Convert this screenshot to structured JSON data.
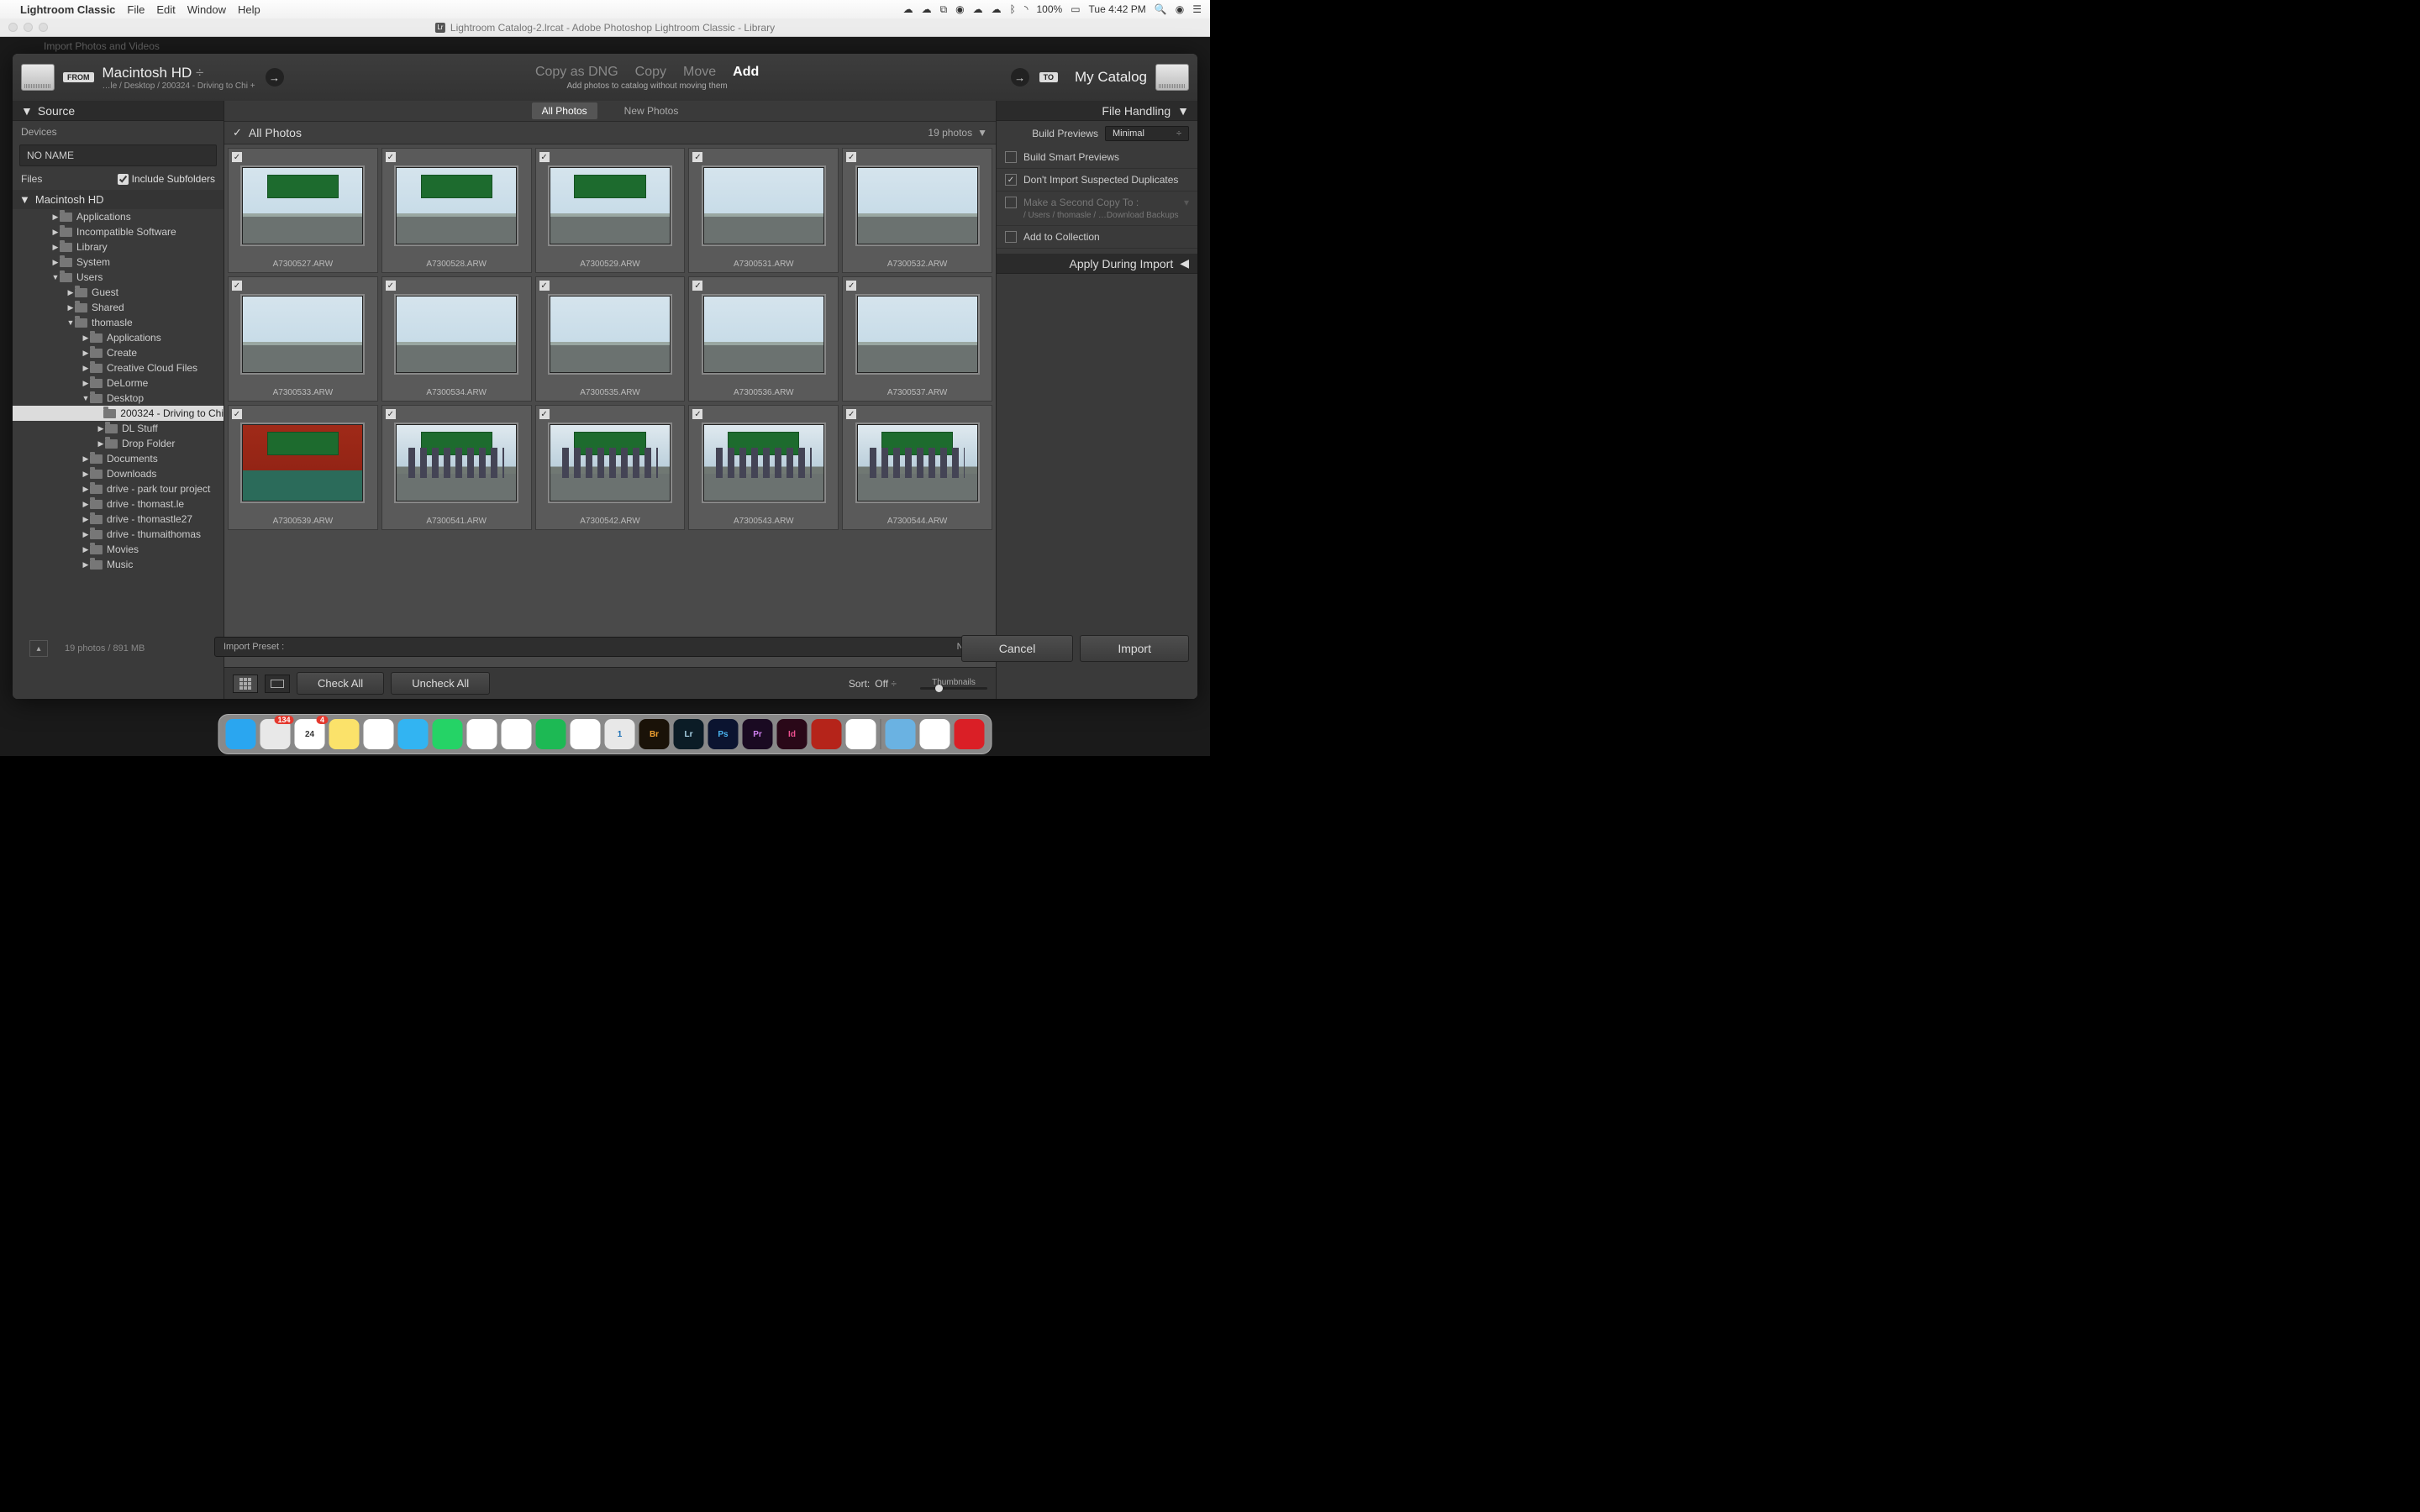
{
  "menubar": {
    "app": "Lightroom Classic",
    "items": [
      "File",
      "Edit",
      "Window",
      "Help"
    ],
    "battery": "100%",
    "clock": "Tue 4:42 PM"
  },
  "window_title": "Lightroom Catalog-2.lrcat - Adobe Photoshop Lightroom Classic - Library",
  "import_peek": "Import Photos and Videos",
  "header": {
    "from_label": "FROM",
    "source_name": "Macintosh HD",
    "source_path": "…le / Desktop / 200324 - Driving to Chi +",
    "modes": [
      "Copy as DNG",
      "Copy",
      "Move",
      "Add"
    ],
    "active_mode": "Add",
    "caption": "Add photos to catalog without moving them",
    "to_label": "TO",
    "dest_name": "My Catalog"
  },
  "left": {
    "source_title": "Source",
    "devices_label": "Devices",
    "device_name": "NO NAME",
    "files_label": "Files",
    "include_subfolders": "Include Subfolders",
    "disk_name": "Macintosh HD",
    "tree": [
      {
        "indent": 0,
        "label": "Applications",
        "expand": "▶",
        "active": false
      },
      {
        "indent": 0,
        "label": "Incompatible Software",
        "expand": "▶",
        "active": false
      },
      {
        "indent": 0,
        "label": "Library",
        "expand": "▶",
        "active": false
      },
      {
        "indent": 0,
        "label": "System",
        "expand": "▶",
        "active": false
      },
      {
        "indent": 0,
        "label": "Users",
        "expand": "▼",
        "active": false
      },
      {
        "indent": 1,
        "label": "Guest",
        "expand": "▶",
        "active": false
      },
      {
        "indent": 1,
        "label": "Shared",
        "expand": "▶",
        "active": false
      },
      {
        "indent": 1,
        "label": "thomasle",
        "expand": "▼",
        "active": false
      },
      {
        "indent": 2,
        "label": "Applications",
        "expand": "▶",
        "active": false
      },
      {
        "indent": 2,
        "label": "Create",
        "expand": "▶",
        "active": false
      },
      {
        "indent": 2,
        "label": "Creative Cloud Files",
        "expand": "▶",
        "active": false
      },
      {
        "indent": 2,
        "label": "DeLorme",
        "expand": "▶",
        "active": false
      },
      {
        "indent": 2,
        "label": "Desktop",
        "expand": "▼",
        "active": false
      },
      {
        "indent": 3,
        "label": "200324 - Driving to Chi",
        "expand": "",
        "active": true
      },
      {
        "indent": 3,
        "label": "DL Stuff",
        "expand": "▶",
        "active": false
      },
      {
        "indent": 3,
        "label": "Drop Folder",
        "expand": "▶",
        "active": false
      },
      {
        "indent": 2,
        "label": "Documents",
        "expand": "▶",
        "active": false
      },
      {
        "indent": 2,
        "label": "Downloads",
        "expand": "▶",
        "active": false
      },
      {
        "indent": 2,
        "label": "drive - park tour project",
        "expand": "▶",
        "active": false
      },
      {
        "indent": 2,
        "label": "drive - thomast.le",
        "expand": "▶",
        "active": false
      },
      {
        "indent": 2,
        "label": "drive - thomastle27",
        "expand": "▶",
        "active": false
      },
      {
        "indent": 2,
        "label": "drive - thumaithomas",
        "expand": "▶",
        "active": false
      },
      {
        "indent": 2,
        "label": "Movies",
        "expand": "▶",
        "active": false
      },
      {
        "indent": 2,
        "label": "Music",
        "expand": "▶",
        "active": false
      }
    ]
  },
  "center": {
    "tab_all": "All Photos",
    "tab_new": "New Photos",
    "header_title": "All Photos",
    "count_text": "19 photos",
    "photos": [
      {
        "name": "A7300527.ARW",
        "kind": "sign"
      },
      {
        "name": "A7300528.ARW",
        "kind": "sign"
      },
      {
        "name": "A7300529.ARW",
        "kind": "sign"
      },
      {
        "name": "A7300531.ARW",
        "kind": "nosign"
      },
      {
        "name": "A7300532.ARW",
        "kind": "nosign"
      },
      {
        "name": "A7300533.ARW",
        "kind": "nosign"
      },
      {
        "name": "A7300534.ARW",
        "kind": "nosign"
      },
      {
        "name": "A7300535.ARW",
        "kind": "nosign"
      },
      {
        "name": "A7300536.ARW",
        "kind": "nosign"
      },
      {
        "name": "A7300537.ARW",
        "kind": "nosign"
      },
      {
        "name": "A7300539.ARW",
        "kind": "mural"
      },
      {
        "name": "A7300541.ARW",
        "kind": "city"
      },
      {
        "name": "A7300542.ARW",
        "kind": "city"
      },
      {
        "name": "A7300543.ARW",
        "kind": "city"
      },
      {
        "name": "A7300544.ARW",
        "kind": "city"
      }
    ],
    "check_all": "Check All",
    "uncheck_all": "Uncheck All",
    "sort_label": "Sort:",
    "sort_value": "Off",
    "thumbnails_label": "Thumbnails"
  },
  "right": {
    "file_handling": "File Handling",
    "build_previews_label": "Build Previews",
    "build_previews_value": "Minimal",
    "smart_previews": "Build Smart Previews",
    "no_duplicates": "Don't Import Suspected Duplicates",
    "second_copy": "Make a Second Copy To :",
    "second_copy_path": "/ Users / thomasle / …Download Backups",
    "add_collection": "Add to Collection",
    "apply_during": "Apply During Import"
  },
  "preset": {
    "label": "Import Preset :",
    "value": "None"
  },
  "status_info": "19 photos / 891 MB",
  "buttons": {
    "cancel": "Cancel",
    "import": "Import"
  },
  "dock": [
    {
      "name": "finder",
      "bg": "#2aa6f0",
      "text": ""
    },
    {
      "name": "preview",
      "bg": "#e8e8e8",
      "text": "",
      "badge": "134"
    },
    {
      "name": "calendar",
      "bg": "#fff",
      "text": "24",
      "badge": "4",
      "color": "#333"
    },
    {
      "name": "notes",
      "bg": "#fbe26a",
      "text": ""
    },
    {
      "name": "reminders",
      "bg": "#fff",
      "text": ""
    },
    {
      "name": "messages",
      "bg": "#32b4f2",
      "text": ""
    },
    {
      "name": "whatsapp",
      "bg": "#25d366",
      "text": ""
    },
    {
      "name": "photos",
      "bg": "#fff",
      "text": ""
    },
    {
      "name": "yelp",
      "bg": "#fff",
      "text": ""
    },
    {
      "name": "spotify",
      "bg": "#1db954",
      "text": ""
    },
    {
      "name": "chrome",
      "bg": "#fff",
      "text": ""
    },
    {
      "name": "1password",
      "bg": "#e8e8e8",
      "text": "1",
      "color": "#1a6fb5"
    },
    {
      "name": "bridge",
      "bg": "#1a1208",
      "text": "Br",
      "color": "#f0a030"
    },
    {
      "name": "lightroom",
      "bg": "#0b1c26",
      "text": "Lr",
      "color": "#aad4e8"
    },
    {
      "name": "photoshop",
      "bg": "#0b1430",
      "text": "Ps",
      "color": "#4ab4f0"
    },
    {
      "name": "premiere",
      "bg": "#1a0a22",
      "text": "Pr",
      "color": "#d080f0"
    },
    {
      "name": "indesign",
      "bg": "#2a0818",
      "text": "Id",
      "color": "#f05090"
    },
    {
      "name": "acrobat",
      "bg": "#b5241a",
      "text": ""
    },
    {
      "name": "slack",
      "bg": "#fff",
      "text": ""
    },
    {
      "name": "folder",
      "bg": "#6ab2e2",
      "text": ""
    },
    {
      "name": "music",
      "bg": "#fff",
      "text": ""
    },
    {
      "name": "cc",
      "bg": "#da1f26",
      "text": ""
    }
  ]
}
